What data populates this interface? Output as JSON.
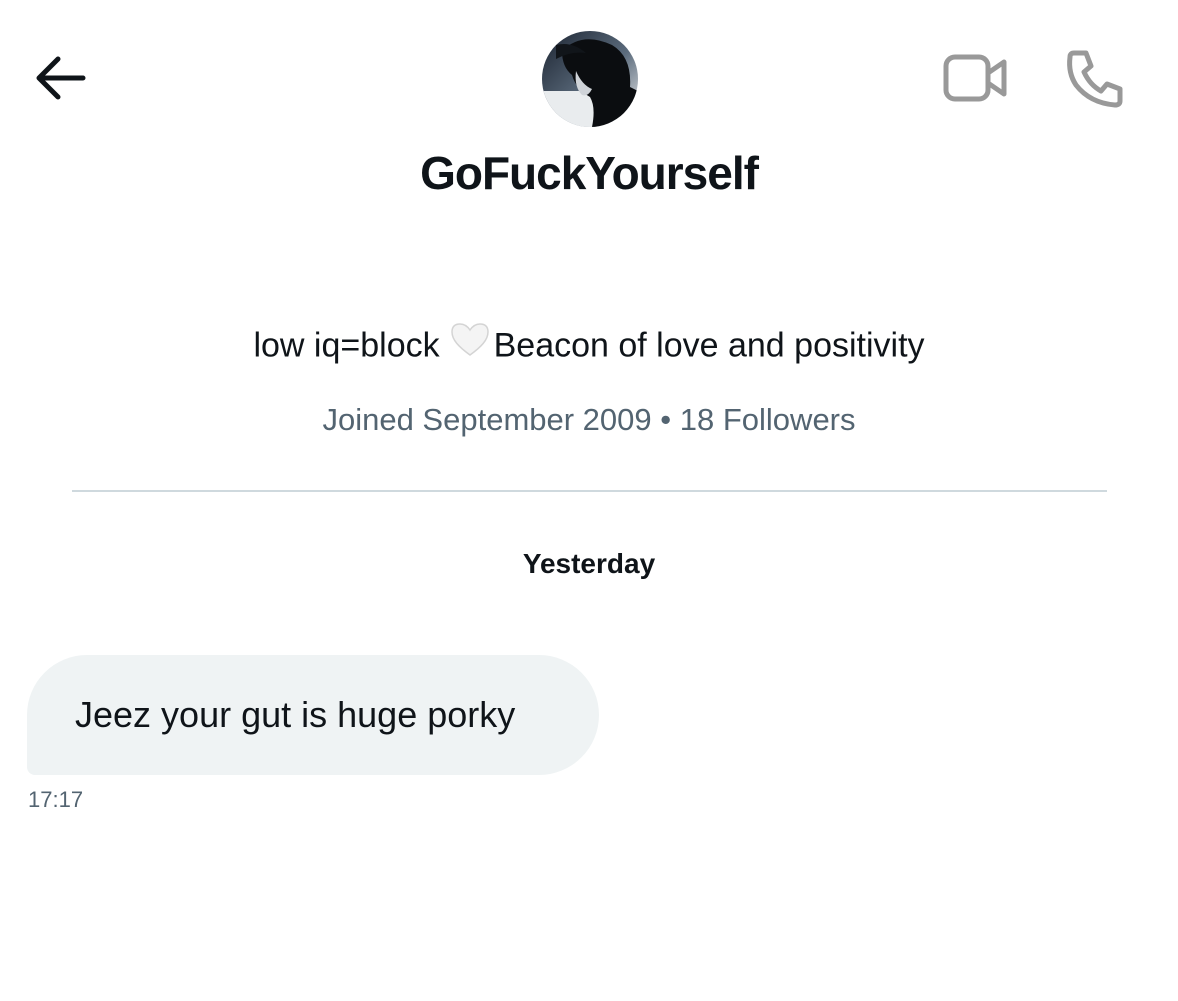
{
  "header": {
    "back_icon": "arrow-left-icon",
    "video_icon": "video-camera-icon",
    "call_icon": "phone-icon",
    "avatar_icon": "profile-avatar",
    "icon_color": "#0f1419",
    "secondary_icon_color": "#999999"
  },
  "profile": {
    "display_name": "GoFuckYourself",
    "bio_before": "low iq=block",
    "bio_emoji": "white-heart-icon",
    "bio_after": "Beacon of love and positivity",
    "joined": "Joined September 2009",
    "separator": "•",
    "followers": "18 Followers"
  },
  "conversation": {
    "date_separator": "Yesterday",
    "messages": [
      {
        "text": "Jeez your gut is huge porky",
        "time": "17:17"
      }
    ]
  },
  "colors": {
    "bubble_bg": "#eff3f4",
    "secondary_text": "#536471",
    "divider": "#cfd9de"
  }
}
